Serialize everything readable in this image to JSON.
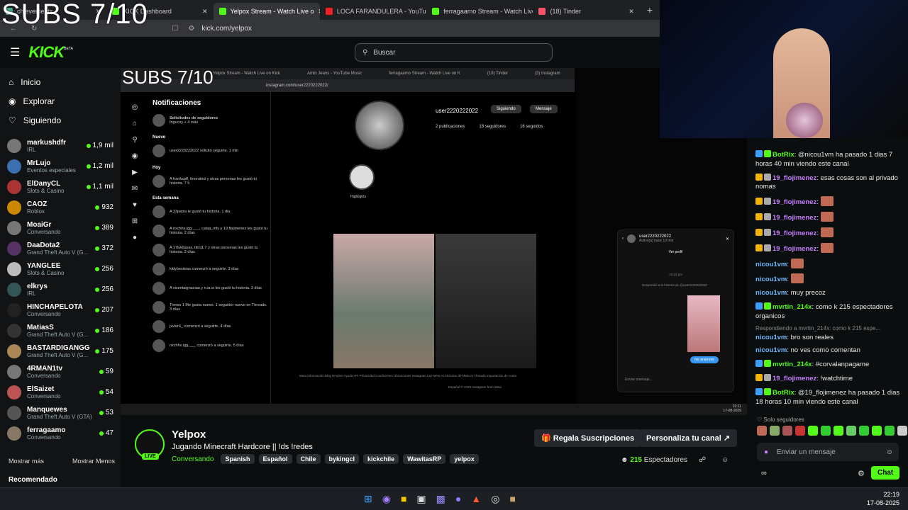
{
  "overlay": {
    "subs_text": "SUBS 7/10",
    "subs_text_inner": "SUBS 7/10"
  },
  "browser": {
    "tabs": [
      {
        "label": "chievements",
        "color": "#4a8"
      },
      {
        "label": "KICK Dashboard",
        "color": "#53fc18"
      },
      {
        "label": "Yelpox Stream - Watch Live o",
        "color": "#53fc18",
        "active": true
      },
      {
        "label": "LOCA FARANDULERA - YouTube",
        "color": "#e22"
      },
      {
        "label": "ferragaamo Stream - Watch Live on K",
        "color": "#53fc18"
      },
      {
        "label": "(18) Tinder",
        "color": "#fe5268"
      }
    ],
    "new_tab": "+",
    "url": "kick.com/yelpox"
  },
  "header": {
    "logo": "KICK",
    "beta": "BETA",
    "search_placeholder": "Buscar"
  },
  "nav": {
    "home": "Inicio",
    "explore": "Explorar",
    "following": "Siguiendo"
  },
  "sidebar_channels": [
    {
      "name": "markushdfr",
      "game": "IRL",
      "viewers": "1,9 mil",
      "color": "#777"
    },
    {
      "name": "MrLujo",
      "game": "Eventos especiales",
      "viewers": "1,2 mil",
      "color": "#3b6fb0"
    },
    {
      "name": "ElDanyCL",
      "game": "Slots & Casino",
      "viewers": "1,1 mil",
      "color": "#a33"
    },
    {
      "name": "CAOZ",
      "game": "Roblox",
      "viewers": "932",
      "color": "#c80"
    },
    {
      "name": "MoaiGr",
      "game": "Conversando",
      "viewers": "389",
      "color": "#777"
    },
    {
      "name": "DaaDota2",
      "game": "Grand Theft Auto V (G...",
      "viewers": "372",
      "color": "#536"
    },
    {
      "name": "YANGLEE",
      "game": "Slots & Casino",
      "viewers": "256",
      "color": "#bbb"
    },
    {
      "name": "elkrys",
      "game": "IRL",
      "viewers": "256",
      "color": "#355"
    },
    {
      "name": "HINCHAPELOTA",
      "game": "Conversando",
      "viewers": "207",
      "color": "#222"
    },
    {
      "name": "MatiasS",
      "game": "Grand Theft Auto V (G...",
      "viewers": "186",
      "color": "#333"
    },
    {
      "name": "BASTARDIGANGG",
      "game": "Grand Theft Auto V (G...",
      "viewers": "175",
      "color": "#a85"
    },
    {
      "name": "4RMAN1tv",
      "game": "Conversando",
      "viewers": "59",
      "color": "#777"
    },
    {
      "name": "ElSaizet",
      "game": "Conversando",
      "viewers": "54",
      "color": "#b55"
    },
    {
      "name": "Manquewes",
      "game": "Grand Theft Auto V (GTA)",
      "viewers": "53",
      "color": "#555"
    },
    {
      "name": "ferragaamo",
      "game": "Conversando",
      "viewers": "47",
      "color": "#876"
    }
  ],
  "sidebar_footer": {
    "show_more": "Mostrar más",
    "show_less": "Mostrar Menos",
    "recommended": "Recomendado"
  },
  "inner_browser": {
    "tabs": [
      "Yelpox Stream - Watch Live on Kick",
      "Amin Jeans - YouTube Music",
      "ferragaamo Stream - Watch Live on K",
      "(18) Tinder",
      "(3) Instagram"
    ],
    "url": "instagram.com/user2220222022/"
  },
  "instagram": {
    "notifications_title": "Notificaciones",
    "follow_requests": "Solicitudes de seguidores",
    "follow_requests_sub": "fogucxy + 4 más",
    "section_new": "Nuevo",
    "section_today": "Hoy",
    "section_week": "Esta semana",
    "items": [
      "user2220222022 solicitó seguirte. 1 min",
      "A frankspff, fmoralesi y otras personas les gustó tu historia. 7 h",
      "A 33pepis le gustó tu historia. 1 día",
      "A nxchhx.igg.___, cataa_mly y 19.flojimenez les gustó tu historia. 2 días",
      "A 17lukitasss, titinj1.7 y otras personas les gustó tu historia. 2 días",
      "kittybesitoss comenzó a seguirte. 3 días",
      "A vicentaignaciaa y n.ia.w les gustó tu historia. 3 días",
      "Tienes 1 Me gusta nuevo. 1 seguidor nuevo en Threads. 3 días",
      "jxvier4_ comenzó a seguirte. 4 días",
      "nxchhx.igg.___ comenzó a seguirte. 5 días"
    ],
    "profile_username": "user2220222022",
    "following_btn": "Siguiendo",
    "message_btn": "Mensaje",
    "posts": "2 publicaciones",
    "followers": "18 seguidores",
    "following": "16 seguidos",
    "highlights": "Highlights",
    "footer": "Meta   Información   Blog   Empleo   Ayuda   API   Privacidad   Condiciones   Ubicaciones   Instagram Lite   Meta AI   Artículos de Meta AI   Threads   Importación de conta",
    "footer2": "Español   © 2025 Instagram from Meta",
    "dm_user": "user2220222022",
    "dm_status": "Activo(a) hace 10 min",
    "dm_view_profile": "Ver perfil",
    "dm_time": "10:13 pm",
    "dm_reply_note": "Respondió a la historia de @user2220222022",
    "dm_bubble": "me enamore",
    "dm_input": "Enviar mensaje...",
    "inner_clock": "22:11",
    "inner_date": "17-08-2025"
  },
  "stream_info": {
    "streamer": "Yelpox",
    "live": "LIVE",
    "title": "Jugando Minecraft Hardcore || !ds !redes",
    "category": "Conversando",
    "tags": [
      "Spanish",
      "Español",
      "Chile",
      "bykingcl",
      "kickchile",
      "WawitasRP",
      "yelpox"
    ],
    "gift_btn": "Regala Suscripciones",
    "customize_btn": "Personaliza tu canal",
    "viewers_count": "215",
    "viewers_label": "Espectadores"
  },
  "chat": {
    "messages": [
      {
        "user": "BotRix",
        "color": "#53fc18",
        "text": "@nicou1vm ha pasado 1 dias 7 horas 40 min viendo este canal",
        "badges": [
          "#3ba0ff",
          "#53fc18"
        ]
      },
      {
        "user": "19_flojimenez",
        "color": "#c77dff",
        "text": "esas cosas son al privado nomas",
        "badges": [
          "#f5b400",
          "#aaa"
        ]
      },
      {
        "user": "19_flojimenez",
        "color": "#c77dff",
        "text": "",
        "emote": true,
        "badges": [
          "#f5b400",
          "#aaa"
        ]
      },
      {
        "user": "19_flojimenez",
        "color": "#c77dff",
        "text": "",
        "emote": true,
        "badges": [
          "#f5b400",
          "#aaa"
        ]
      },
      {
        "user": "19_flojimenez",
        "color": "#c77dff",
        "text": "",
        "emote": true,
        "badges": [
          "#f5b400",
          "#aaa"
        ]
      },
      {
        "user": "19_flojimenez",
        "color": "#c77dff",
        "text": "",
        "emote": true,
        "badges": [
          "#f5b400",
          "#aaa"
        ]
      },
      {
        "user": "nicou1vm",
        "color": "#6cb8ff",
        "text": "",
        "emote": true,
        "badges": []
      },
      {
        "user": "nicou1vm",
        "color": "#6cb8ff",
        "text": "",
        "emote": true,
        "badges": []
      },
      {
        "user": "nicou1vm",
        "color": "#6cb8ff",
        "text": "muy precoz",
        "badges": []
      },
      {
        "user": "mvrtin_214x",
        "color": "#53fc18",
        "text": "como k 215 espectadores organicos",
        "badges": [
          "#3ba0ff",
          "#53fc18"
        ]
      },
      {
        "user": "nicou1vm",
        "color": "#6cb8ff",
        "text": "bro son reales",
        "badges": [],
        "reply": "Respondiendo a mvrtin_214x: como k 215 espe..."
      },
      {
        "user": "nicou1vm",
        "color": "#6cb8ff",
        "text": "no ves como comentan",
        "badges": []
      },
      {
        "user": "mvrtin_214x",
        "color": "#53fc18",
        "text": "#corvalanpagame",
        "badges": [
          "#3ba0ff",
          "#53fc18"
        ]
      },
      {
        "user": "19_flojimenez",
        "color": "#c77dff",
        "text": "!watchtime",
        "badges": [
          "#f5b400",
          "#aaa"
        ]
      },
      {
        "user": "BotRix",
        "color": "#53fc18",
        "text": "@19_flojimenez ha pasado 1 dias 18 horas 10 min viendo este canal",
        "badges": [
          "#3ba0ff",
          "#53fc18"
        ]
      }
    ],
    "followers_only": "Solo seguidores",
    "input_placeholder": "Enviar un mensaje",
    "chat_btn": "Chat"
  },
  "taskbar": {
    "time": "22:19",
    "date": "17-08-2025"
  }
}
